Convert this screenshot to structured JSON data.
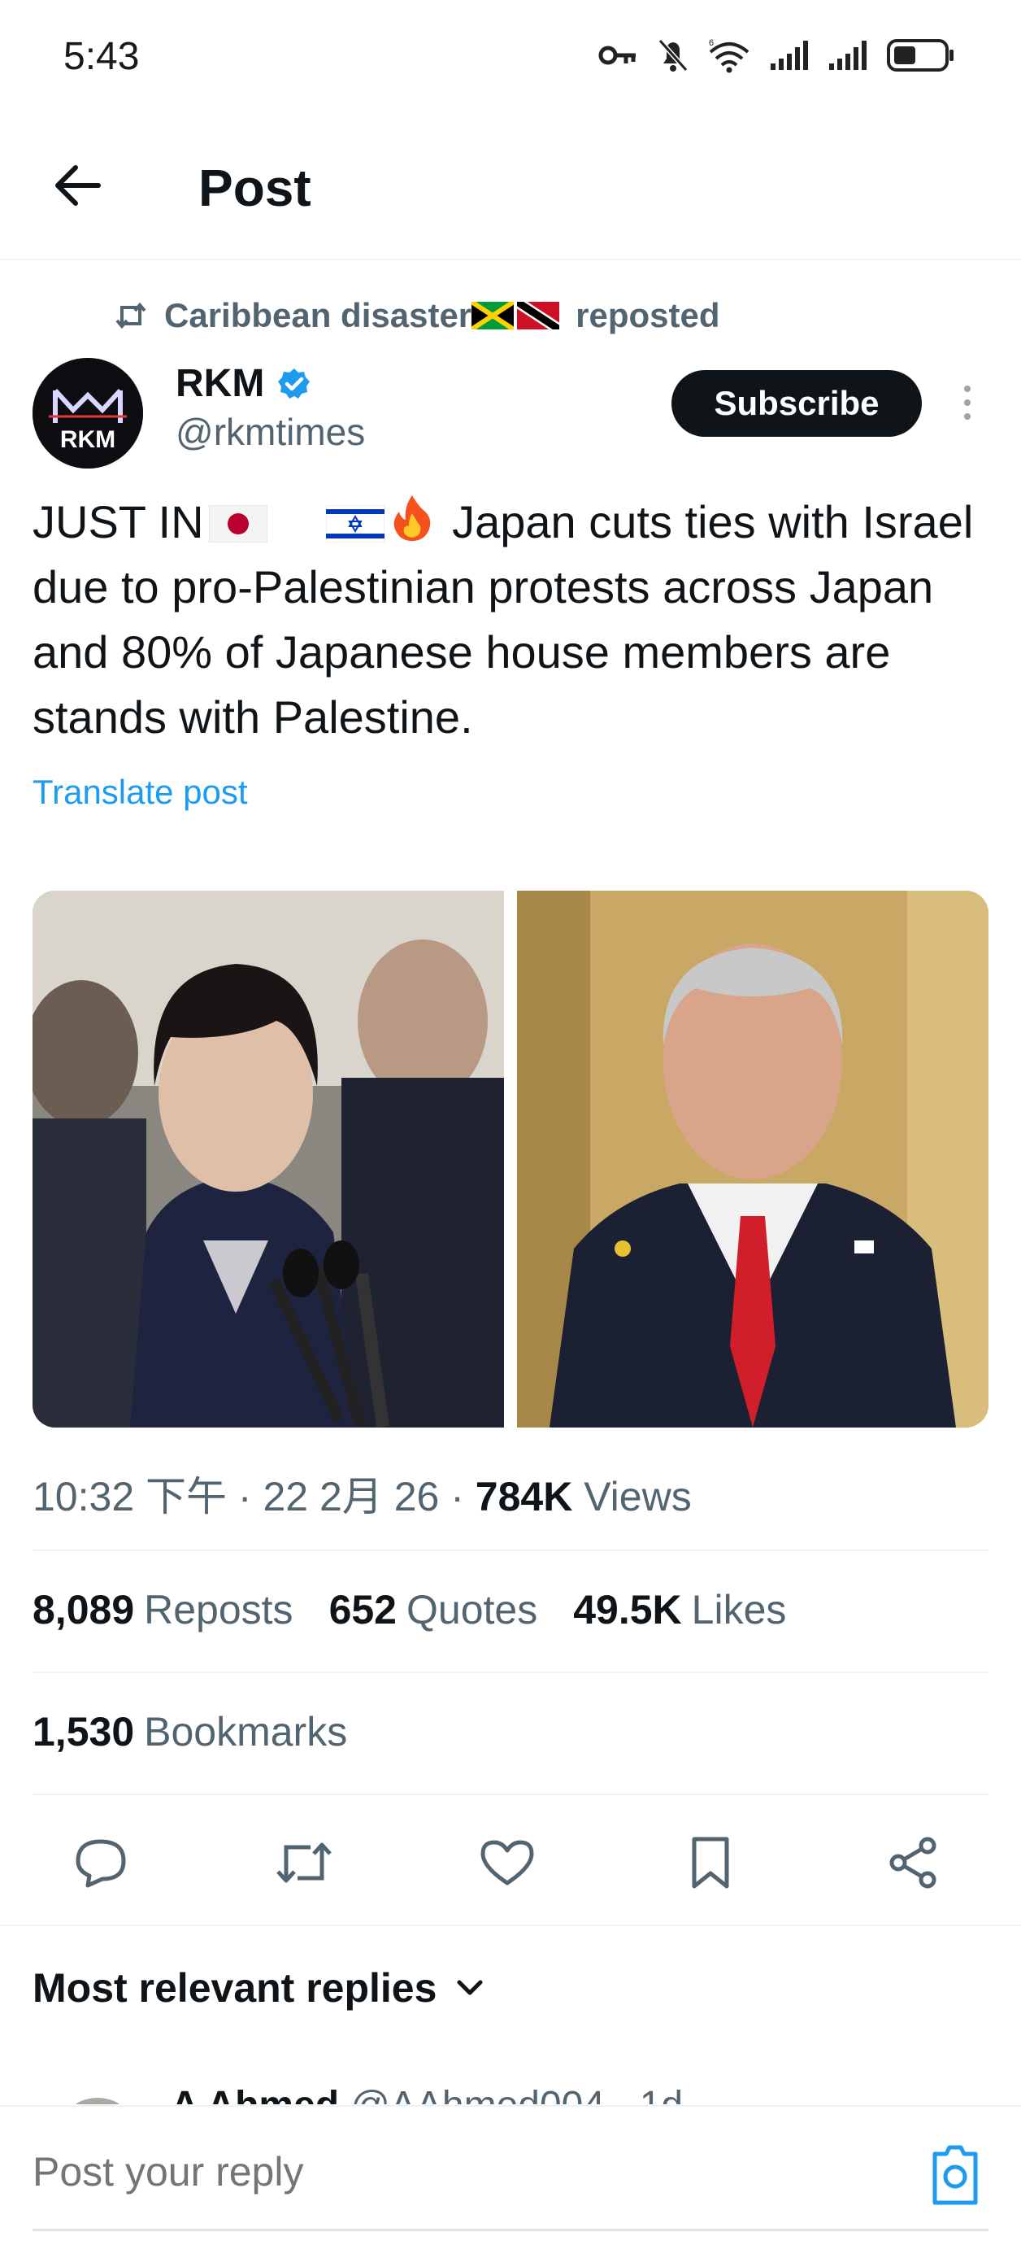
{
  "status_bar": {
    "time": "5:43",
    "icons": [
      "key-icon",
      "bell-muted-icon",
      "wifi-6-icon",
      "signal-icon",
      "signal-icon",
      "battery-icon"
    ]
  },
  "header": {
    "title": "Post",
    "back_icon": "arrow-left-icon"
  },
  "repost": {
    "reposter": "Caribbean disaster",
    "suffix": "reposted",
    "icon": "repost-icon"
  },
  "author": {
    "avatar_text": "RKM",
    "name": "RKM",
    "handle": "@rkmtimes",
    "verified": true,
    "subscribe_label": "Subscribe"
  },
  "post": {
    "text_prefix": "JUST IN",
    "text_main": " Japan cuts ties with Israel due to pro-Palestinian protests across Japan and 80% of Japanese house members are stands with Palestine.",
    "translate_label": "Translate post"
  },
  "meta": {
    "time": "10:32 下午",
    "date": "22 2月 26",
    "views_count": "784K",
    "views_label": "Views",
    "sep": "·"
  },
  "stats": {
    "reposts_count": "8,089",
    "reposts_label": "Reposts",
    "quotes_count": "652",
    "quotes_label": "Quotes",
    "likes_count": "49.5K",
    "likes_label": "Likes",
    "bookmarks_count": "1,530",
    "bookmarks_label": "Bookmarks"
  },
  "actions": [
    "reply-icon",
    "repost-icon",
    "like-icon",
    "bookmark-icon",
    "share-icon"
  ],
  "replies": {
    "heading": "Most relevant replies",
    "peek_name": "A Ahmed",
    "peek_handle": "@AAhmed004 · 1d"
  },
  "composer": {
    "placeholder": "Post your reply"
  },
  "colors": {
    "accent": "#1d9bf0",
    "text_primary": "#0f1419",
    "text_secondary": "#536471"
  }
}
